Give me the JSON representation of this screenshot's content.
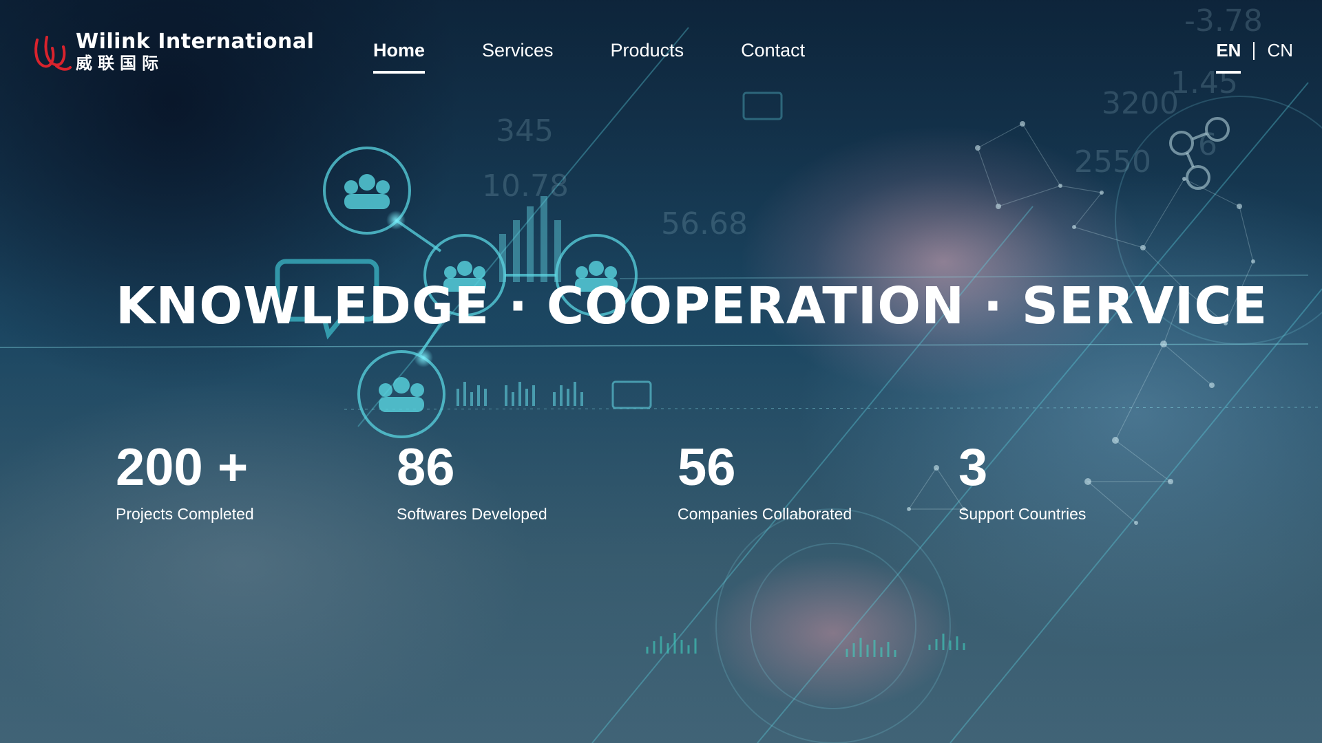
{
  "brand": {
    "name_en": "Wilink International",
    "name_cn": "威联国际",
    "accent_color": "#d9232d"
  },
  "nav": {
    "items": [
      {
        "label": "Home",
        "active": true
      },
      {
        "label": "Services",
        "active": false
      },
      {
        "label": "Products",
        "active": false
      },
      {
        "label": "Contact",
        "active": false
      }
    ]
  },
  "language": {
    "options": [
      {
        "label": "EN",
        "active": true
      },
      {
        "label": "CN",
        "active": false
      }
    ]
  },
  "hero": {
    "headline": "KNOWLEDGE · COOPERATION · SERVICE"
  },
  "stats": [
    {
      "value": "200 +",
      "label": "Projects Completed"
    },
    {
      "value": "86",
      "label": "Softwares Developed"
    },
    {
      "value": "56",
      "label": "Companies Collaborated"
    },
    {
      "value": "3",
      "label": "Support Countries"
    }
  ]
}
